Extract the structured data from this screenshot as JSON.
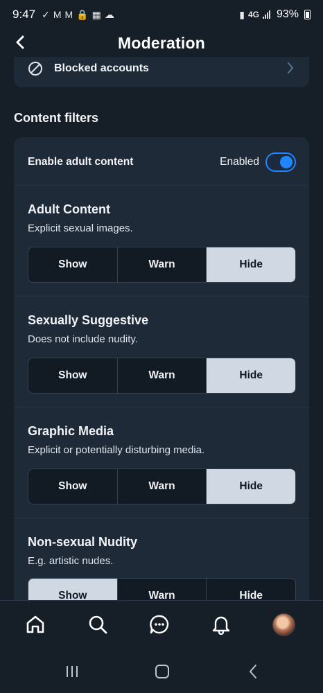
{
  "status_bar": {
    "time": "9:47",
    "network": "4G",
    "battery": "93%"
  },
  "header": {
    "title": "Moderation"
  },
  "blocked_accounts": {
    "label": "Blocked accounts"
  },
  "content_filters": {
    "section_title": "Content filters",
    "adult_content_toggle": {
      "label": "Enable adult content",
      "state_label": "Enabled",
      "enabled": true
    },
    "filters": [
      {
        "title": "Adult Content",
        "description": "Explicit sexual images.",
        "options": [
          "Show",
          "Warn",
          "Hide"
        ],
        "selected": "Hide"
      },
      {
        "title": "Sexually Suggestive",
        "description": "Does not include nudity.",
        "options": [
          "Show",
          "Warn",
          "Hide"
        ],
        "selected": "Hide"
      },
      {
        "title": "Graphic Media",
        "description": "Explicit or potentially disturbing media.",
        "options": [
          "Show",
          "Warn",
          "Hide"
        ],
        "selected": "Hide"
      },
      {
        "title": "Non-sexual Nudity",
        "description": "E.g. artistic nudes.",
        "options": [
          "Show",
          "Warn",
          "Hide"
        ],
        "selected": "Show"
      }
    ]
  },
  "tab_bar": {
    "tabs": [
      "home-icon",
      "search-icon",
      "chat-icon",
      "bell-icon",
      "avatar"
    ]
  },
  "colors": {
    "background": "#161e27",
    "card": "#1e2a38",
    "accent": "#1e86ff",
    "selected_segment": "#cfd8e3"
  }
}
